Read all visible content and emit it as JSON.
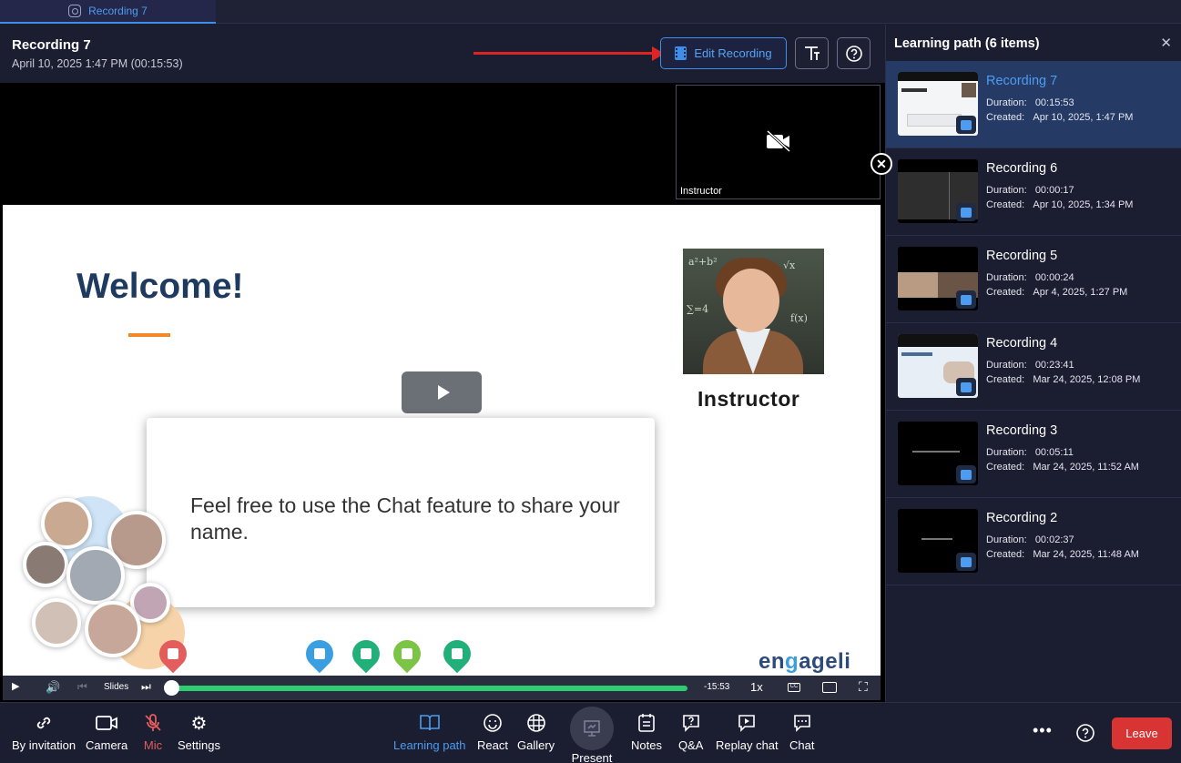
{
  "tab": {
    "label": "Recording 7"
  },
  "header": {
    "title": "Recording 7",
    "date": "April 10, 2025 1:47 PM (00:15:53)",
    "edit_label": "Edit Recording"
  },
  "stage": {
    "camera_label": "Instructor",
    "slide": {
      "welcome": "Welcome!",
      "instructor_caption": "Instructor",
      "card_text": "Feel free to use the Chat feature to share your name.",
      "brand_left": "en",
      "brand_mid": "g",
      "brand_right": "ageli"
    }
  },
  "player": {
    "slides_label": "Slides",
    "time_remaining": "-15:53",
    "speed": "1x",
    "progress": 0
  },
  "sidebar": {
    "title": "Learning path (6 items)",
    "duration_label": "Duration:",
    "created_label": "Created:",
    "items": [
      {
        "name": "Recording 7",
        "duration": "00:15:53",
        "created": "Apr 10, 2025, 1:47 PM"
      },
      {
        "name": "Recording 6",
        "duration": "00:00:17",
        "created": "Apr 10, 2025, 1:34 PM"
      },
      {
        "name": "Recording 5",
        "duration": "00:00:24",
        "created": "Apr 4, 2025, 1:27 PM"
      },
      {
        "name": "Recording 4",
        "duration": "00:23:41",
        "created": "Mar 24, 2025, 12:08 PM"
      },
      {
        "name": "Recording 3",
        "duration": "00:05:11",
        "created": "Mar 24, 2025, 11:52 AM"
      },
      {
        "name": "Recording 2",
        "duration": "00:02:37",
        "created": "Mar 24, 2025, 11:48 AM"
      }
    ]
  },
  "toolbar": {
    "by_invitation": "By invitation",
    "camera": "Camera",
    "mic": "Mic",
    "settings": "Settings",
    "learning_path": "Learning path",
    "react": "React",
    "gallery": "Gallery",
    "present": "Present",
    "notes": "Notes",
    "qa": "Q&A",
    "replay_chat": "Replay chat",
    "chat": "Chat",
    "leave": "Leave"
  },
  "colors": {
    "accent": "#3e8fe8",
    "leave": "#d93434",
    "mic_off": "#e35d5d",
    "progress": "#2ecc71"
  }
}
